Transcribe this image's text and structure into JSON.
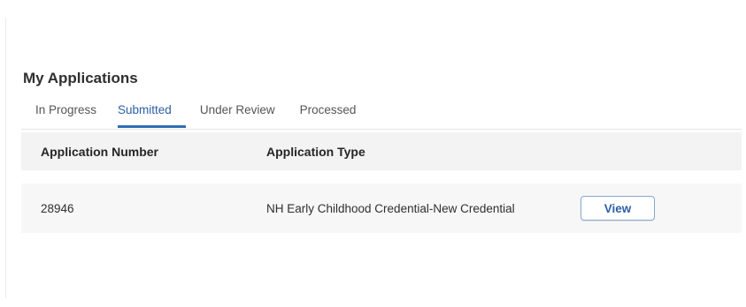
{
  "page": {
    "title": "My Applications"
  },
  "tabs": [
    {
      "label": "In Progress",
      "active": false
    },
    {
      "label": "Submitted",
      "active": true
    },
    {
      "label": "Under Review",
      "active": false
    },
    {
      "label": "Processed",
      "active": false
    }
  ],
  "table": {
    "columns": [
      "Application Number",
      "Application Type"
    ],
    "rows": [
      {
        "application_number": "28946",
        "application_type": "NH Early Childhood Credential-New Credential",
        "action_label": "View"
      }
    ]
  },
  "colors": {
    "accent": "#2f6db5",
    "header_bg": "#f3f3f3",
    "row_bg": "#f7f7f7"
  }
}
